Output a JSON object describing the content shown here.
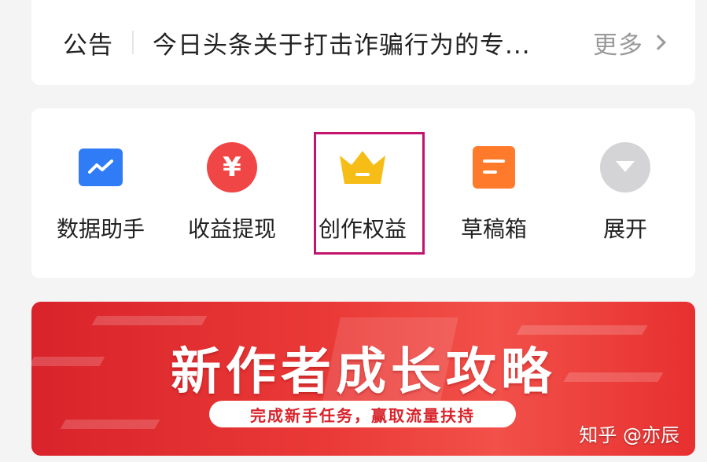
{
  "notice": {
    "label": "公告",
    "text": "今日头条关于打击诈骗行为的专...",
    "more": "更多"
  },
  "tools": {
    "items": [
      {
        "label": "数据助手",
        "icon": "chart-trend-icon"
      },
      {
        "label": "收益提现",
        "icon": "yen-icon"
      },
      {
        "label": "创作权益",
        "icon": "crown-icon"
      },
      {
        "label": "草稿箱",
        "icon": "draft-box-icon"
      },
      {
        "label": "展开",
        "icon": "expand-down-icon"
      }
    ]
  },
  "banner": {
    "title": "新作者成长攻略",
    "subtitle": "完成新手任务，赢取流量扶持",
    "watermark": "知乎 @亦辰"
  },
  "colors": {
    "primary_blue": "#2f7cf6",
    "red": "#f04646",
    "gold": "#f6bd16",
    "orange": "#ff7a2a",
    "highlight": "#c2146c"
  }
}
